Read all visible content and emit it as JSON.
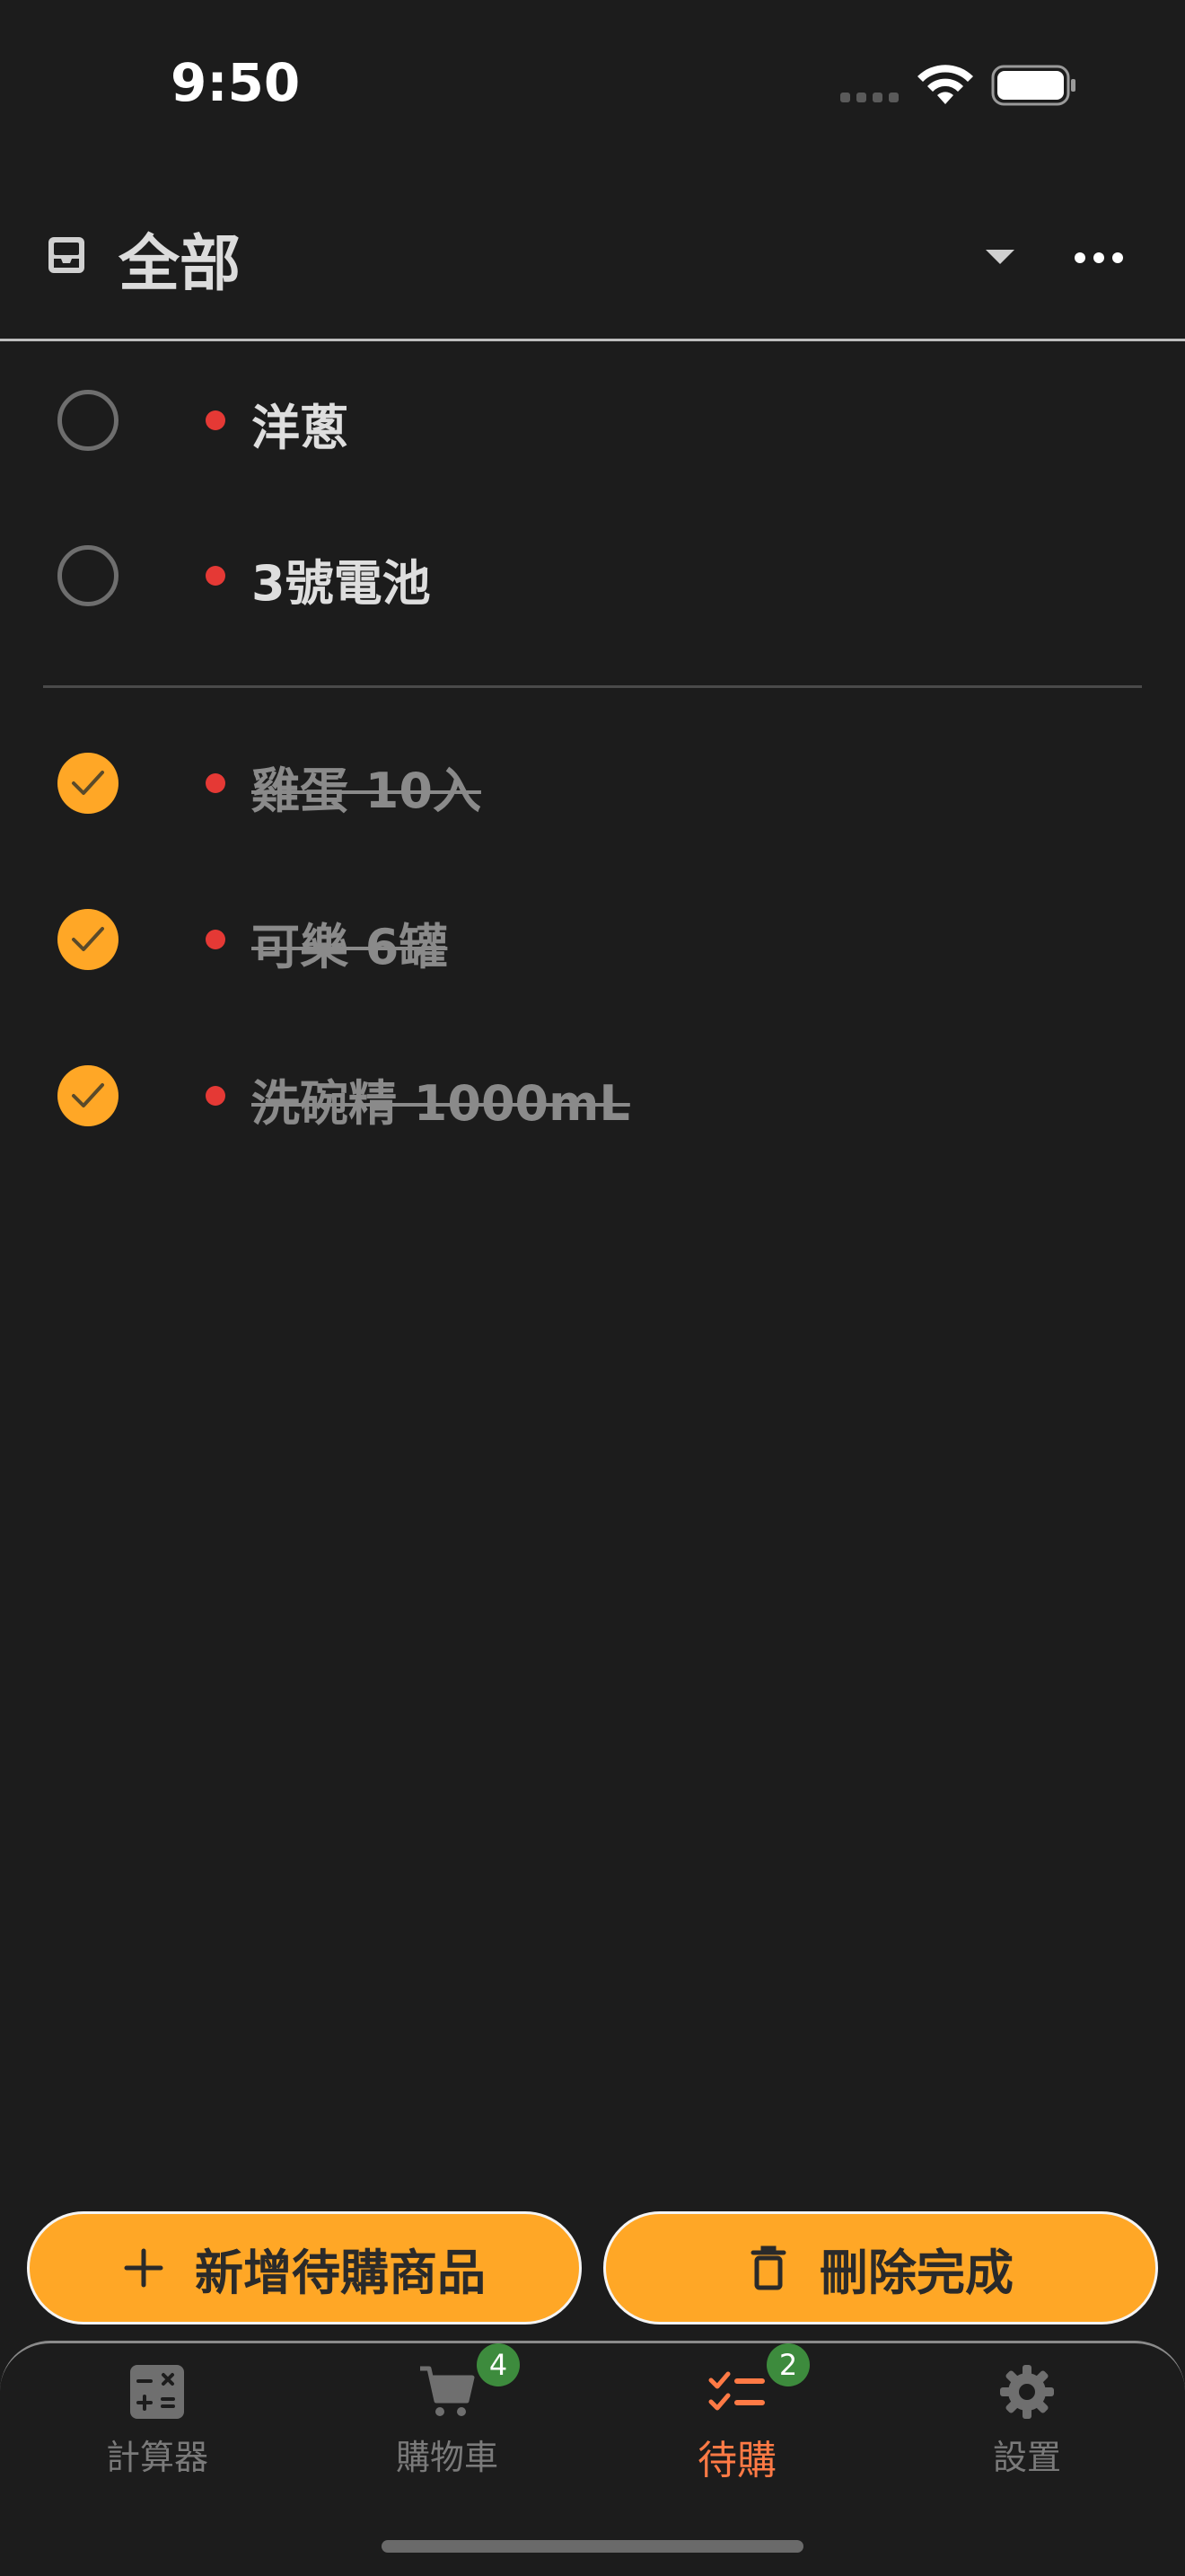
{
  "status_bar": {
    "time": "9:50"
  },
  "header": {
    "title": "全部",
    "icon": "inbox-icon"
  },
  "pending_items": [
    {
      "label": "洋蔥",
      "done": false
    },
    {
      "label": "3號電池",
      "done": false
    }
  ],
  "done_items": [
    {
      "label": "雞蛋 10入",
      "done": true
    },
    {
      "label": "可樂 6罐",
      "done": true
    },
    {
      "label": "洗碗精 1000mL",
      "done": true
    }
  ],
  "actions": {
    "add_label": "新增待購商品",
    "delete_label": "刪除完成"
  },
  "tabs": [
    {
      "label": "計算器",
      "icon": "calculator-icon",
      "active": false
    },
    {
      "label": "購物車",
      "icon": "cart-icon",
      "badge": "4",
      "active": false
    },
    {
      "label": "待購",
      "icon": "checklist-icon",
      "badge": "2",
      "active": true
    },
    {
      "label": "設置",
      "icon": "gear-icon",
      "active": false
    }
  ],
  "colors": {
    "background": "#1c1c1c",
    "accent": "#ffa726",
    "active_tab": "#ff7a45",
    "priority_dot": "#e53935",
    "badge": "#3d8b3d"
  }
}
